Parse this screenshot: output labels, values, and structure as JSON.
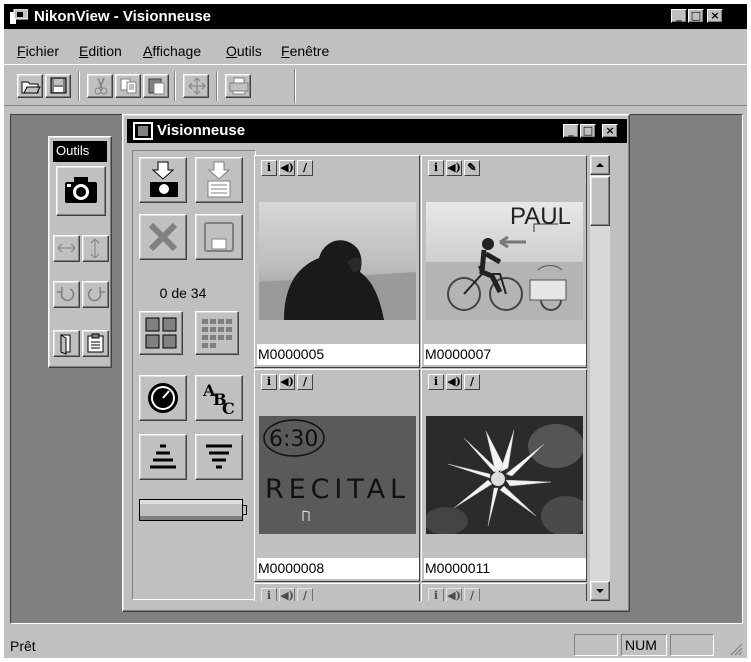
{
  "window": {
    "title": "NikonView - Visionneuse",
    "controls": [
      "_",
      "□",
      "×"
    ]
  },
  "menu": [
    {
      "label": "Fichier",
      "key": "F",
      "rest": "ichier"
    },
    {
      "label": "Edition",
      "key": "E",
      "rest": "dition"
    },
    {
      "label": "Affichage",
      "key": "A",
      "rest": "ffichage"
    },
    {
      "label": "Outils",
      "key": "O",
      "rest": "utils"
    },
    {
      "label": "Fenêtre",
      "key": "F",
      "rest": "enêtre"
    }
  ],
  "toolbar": {
    "icons": [
      "open-folder-icon",
      "save-disk-icon",
      "cut-scissors-icon",
      "copy-icon",
      "paste-icon",
      "move-arrows-icon",
      "print-icon"
    ]
  },
  "outils": {
    "title": "Outils",
    "icons": [
      "camera-icon",
      "flip-horizontal-icon",
      "flip-vertical-icon",
      "rotate-left-icon",
      "rotate-right-icon",
      "open-file-icon",
      "properties-icon"
    ]
  },
  "viewer": {
    "title": "Visionneuse",
    "counter": "0 de 34",
    "left_buttons": [
      "download-to-camera-icon",
      "download-selected-icon",
      "delete-icon",
      "save-icon",
      "large-thumbnails-icon",
      "small-thumbnails-icon",
      "sort-by-date-icon",
      "sort-by-name-icon",
      "sort-ascending-icon",
      "sort-descending-icon"
    ],
    "thumbnails": [
      {
        "name": "M0000005",
        "icons": [
          "info-icon",
          "sound-icon",
          "memo-icon"
        ]
      },
      {
        "name": "M0000007",
        "icons": [
          "info-icon",
          "sound-icon",
          "memo-icon"
        ],
        "overlay_text": "PAUL"
      },
      {
        "name": "M0000008",
        "icons": [
          "info-icon",
          "sound-icon",
          "memo-icon"
        ],
        "overlay_text": [
          "6:30",
          "RECITAL"
        ]
      },
      {
        "name": "M0000011",
        "icons": [
          "info-icon",
          "sound-icon",
          "memo-icon"
        ]
      }
    ]
  },
  "status": {
    "text": "Prêt",
    "num": "NUM"
  }
}
